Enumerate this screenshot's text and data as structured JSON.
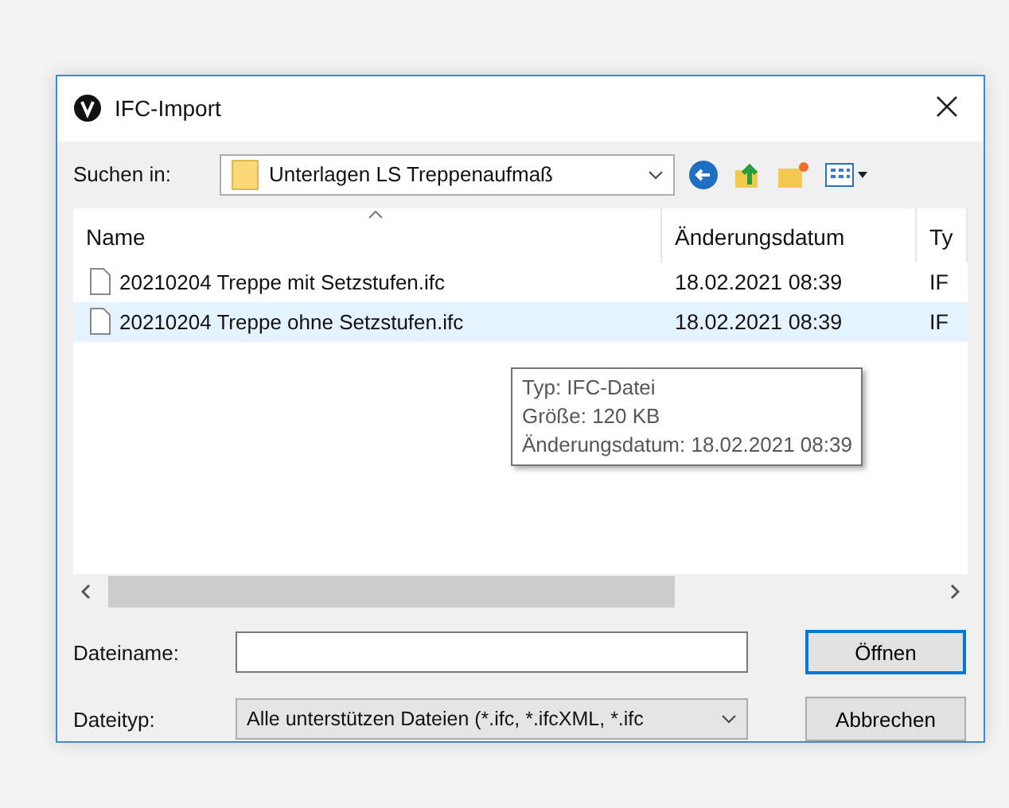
{
  "window": {
    "title": "IFC-Import"
  },
  "look_in": {
    "label": "Suchen in:",
    "value": "Unterlagen LS Treppenaufmaß"
  },
  "table": {
    "columns": [
      {
        "label": "Name",
        "sorted": true
      },
      {
        "label": "Änderungsdatum",
        "sorted": false
      },
      {
        "label": "Ty",
        "sorted": false
      }
    ],
    "rows": [
      {
        "name": "20210204 Treppe mit Setzstufen.ifc",
        "date": "18.02.2021 08:39",
        "type": "IF",
        "selected": false
      },
      {
        "name": "20210204 Treppe ohne Setzstufen.ifc",
        "date": "18.02.2021 08:39",
        "type": "IF",
        "selected": true
      }
    ]
  },
  "tooltip": [
    "Typ: IFC-Datei",
    "Größe: 120 KB",
    "Änderungsdatum: 18.02.2021 08:39"
  ],
  "filename": {
    "label": "Dateiname:"
  },
  "filetype": {
    "label": "Dateityp:",
    "value": "Alle unterstützen Dateien (*.ifc, *.ifcXML, *.ifc"
  },
  "buttons": [
    {
      "label": "Öffnen",
      "default": true
    },
    {
      "label": "Abbrechen",
      "default": false
    }
  ]
}
